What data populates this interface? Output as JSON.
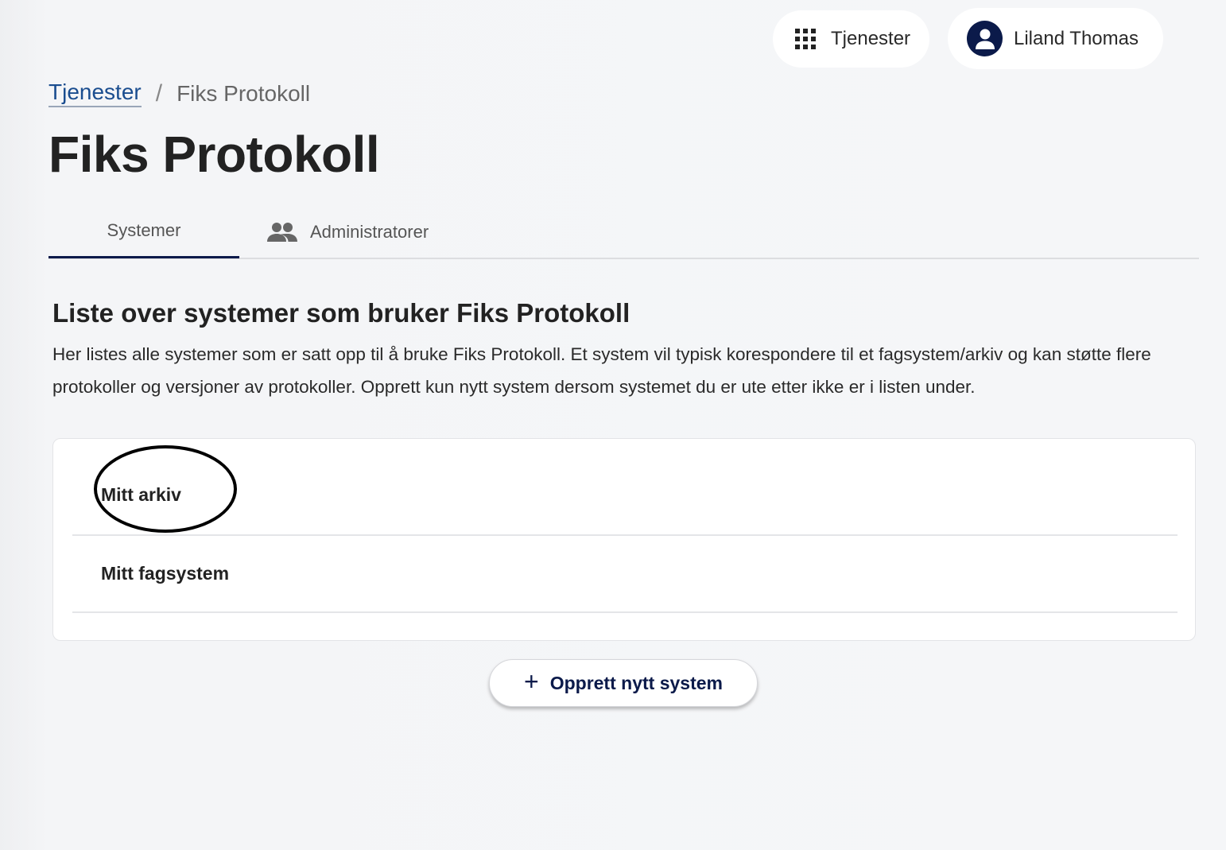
{
  "header": {
    "services_label": "Tjenester",
    "services_icon": "apps-grid-icon",
    "user_name": "Liland Thomas",
    "user_icon": "person-icon"
  },
  "breadcrumb": {
    "parent": "Tjenester",
    "separator": "/",
    "current": "Fiks Protokoll"
  },
  "page": {
    "title": "Fiks Protokoll"
  },
  "tabs": [
    {
      "label": "Systemer",
      "active": true
    },
    {
      "label": "Administratorer",
      "active": false,
      "icon": "people-icon"
    }
  ],
  "section": {
    "title": "Liste over systemer som bruker Fiks Protokoll",
    "description": "Her listes alle systemer som er satt opp til å bruke Fiks Protokoll. Et system vil typisk korespondere til et fagsystem/arkiv og kan støtte flere protokoller og versjoner av protokoller. Opprett kun nytt system dersom systemet du er ute etter ikke er i listen under."
  },
  "systems": [
    {
      "name": "Mitt arkiv",
      "highlighted": true
    },
    {
      "name": "Mitt fagsystem",
      "highlighted": false
    }
  ],
  "create_button": {
    "icon": "plus-icon",
    "label": "Opprett nytt system"
  },
  "colors": {
    "accent": "#0b1a4a",
    "link": "#1a4d8f",
    "background": "#f5f6f8"
  }
}
